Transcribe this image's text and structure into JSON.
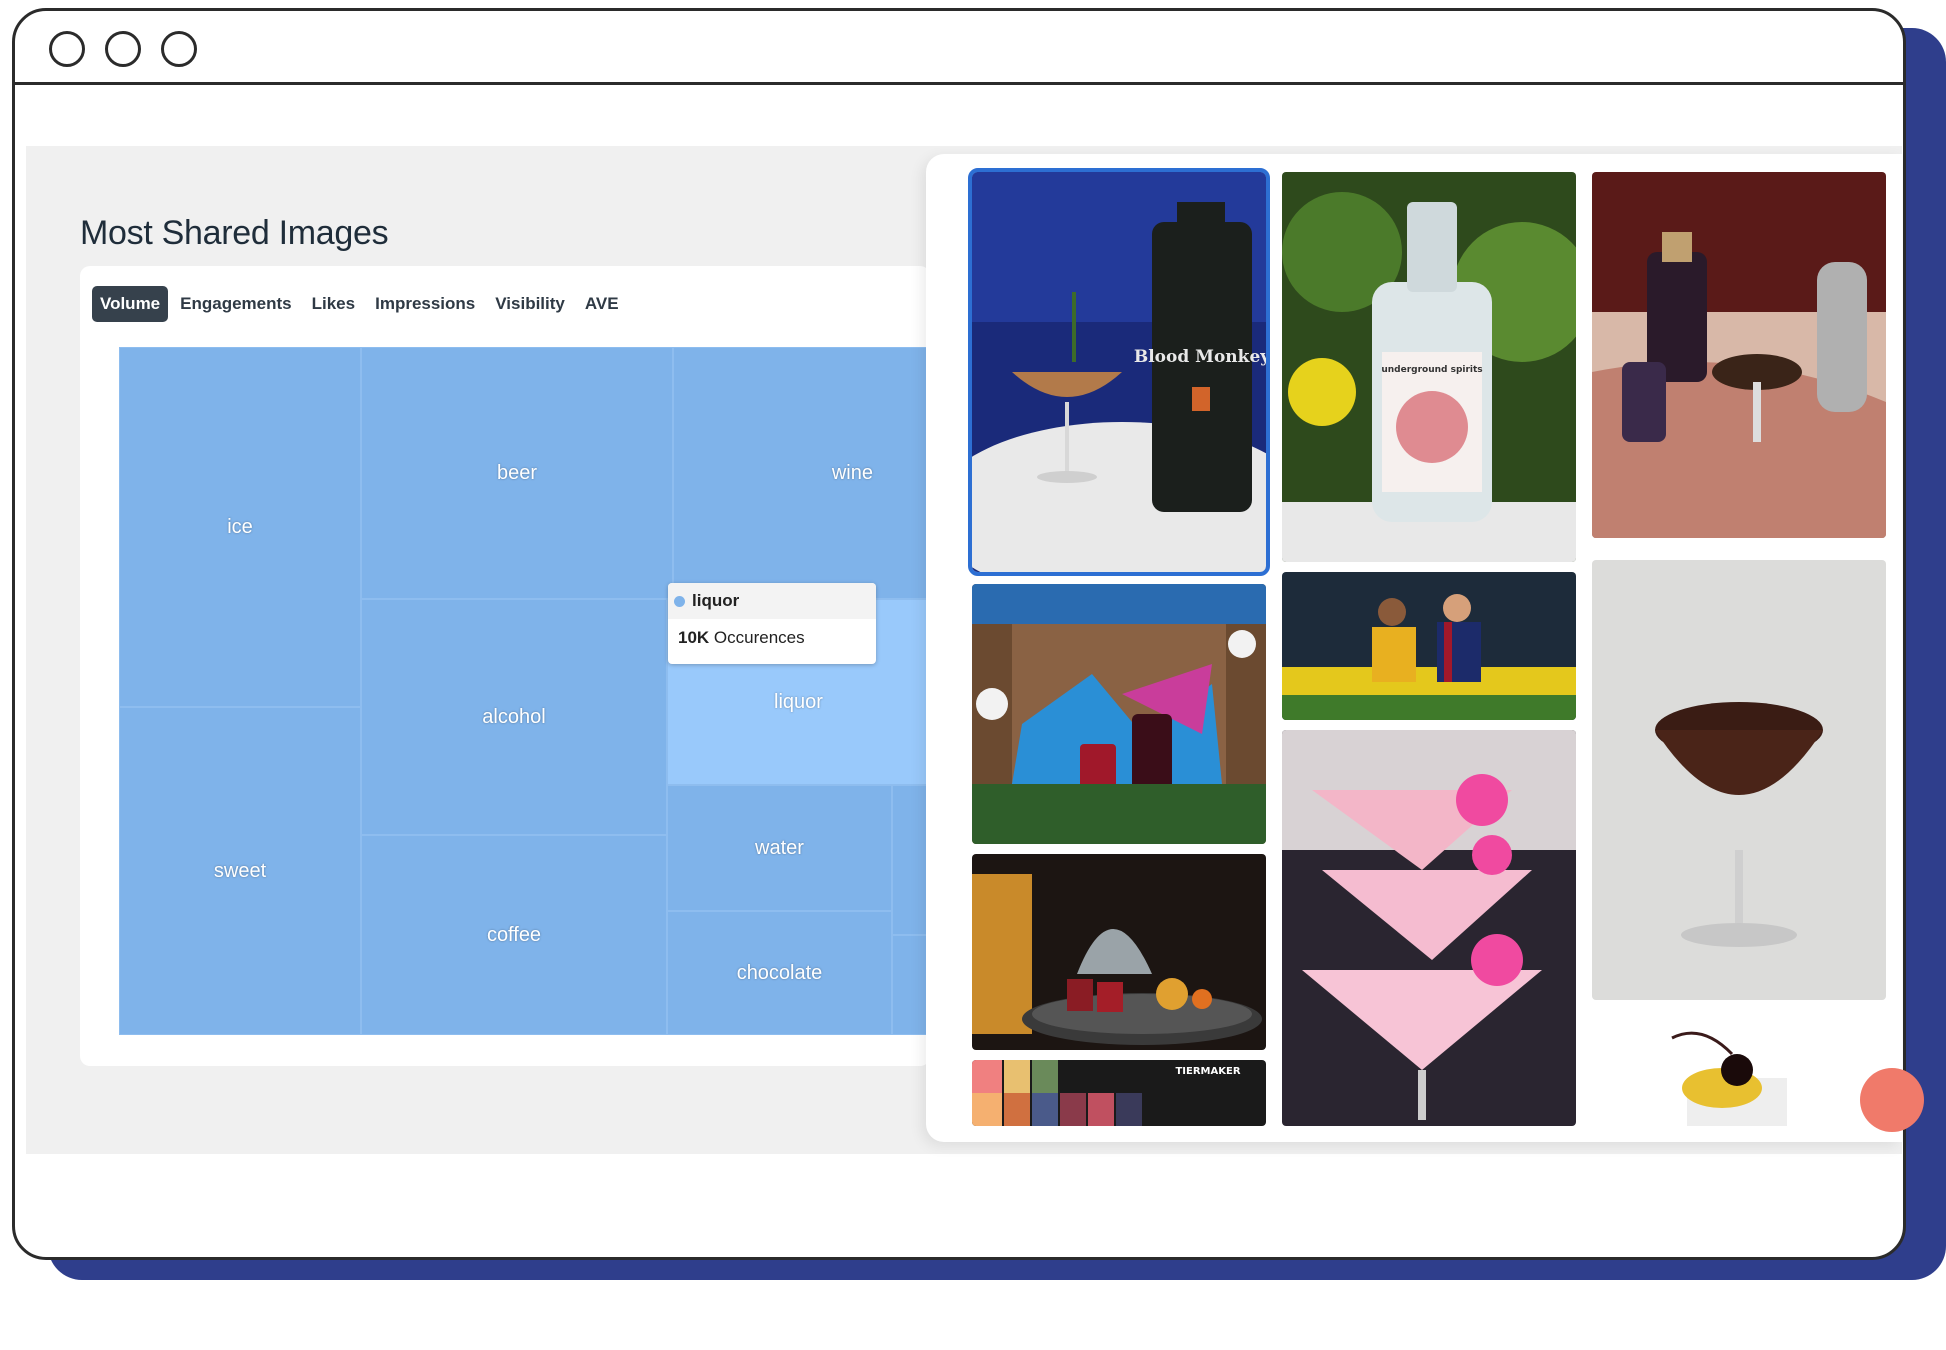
{
  "panel": {
    "title": "Most Shared Images"
  },
  "tabs": [
    {
      "label": "Volume",
      "active": true
    },
    {
      "label": "Engagements",
      "active": false
    },
    {
      "label": "Likes",
      "active": false
    },
    {
      "label": "Impressions",
      "active": false
    },
    {
      "label": "Visibility",
      "active": false
    },
    {
      "label": "AVE",
      "active": false
    }
  ],
  "treemap": {
    "color": "#7fb3ea",
    "highlight_color": "#99c9fb",
    "cells": [
      "ice",
      "sweet",
      "beer",
      "alcohol",
      "coffee",
      "wine",
      "liquor",
      "water",
      "chocolate"
    ]
  },
  "tooltip": {
    "label": "liquor",
    "value": "10K",
    "unit": "Occurences"
  },
  "gallery": {
    "images": [
      {
        "name": "blood-monkey-gin-cocktail",
        "text": "Blood Monkey"
      },
      {
        "name": "underground-spirits-gin-bottle",
        "text": "underground spirits"
      },
      {
        "name": "espresso-martini-marble",
        "text": ""
      },
      {
        "name": "red-drink-gift-display",
        "text": ""
      },
      {
        "name": "football-players",
        "text": ""
      },
      {
        "name": "whisky-tray",
        "text": ""
      },
      {
        "name": "pink-martini-glasses",
        "text": ""
      },
      {
        "name": "dark-cocktail-coupe",
        "text": ""
      },
      {
        "name": "anime-tier-list",
        "text": "TIERMAKER"
      },
      {
        "name": "lemon-cherry-cocktail",
        "text": ""
      }
    ]
  },
  "colors": {
    "selected_outline": "#2d6fd3",
    "frame_shadow": "#2f3e8c"
  }
}
